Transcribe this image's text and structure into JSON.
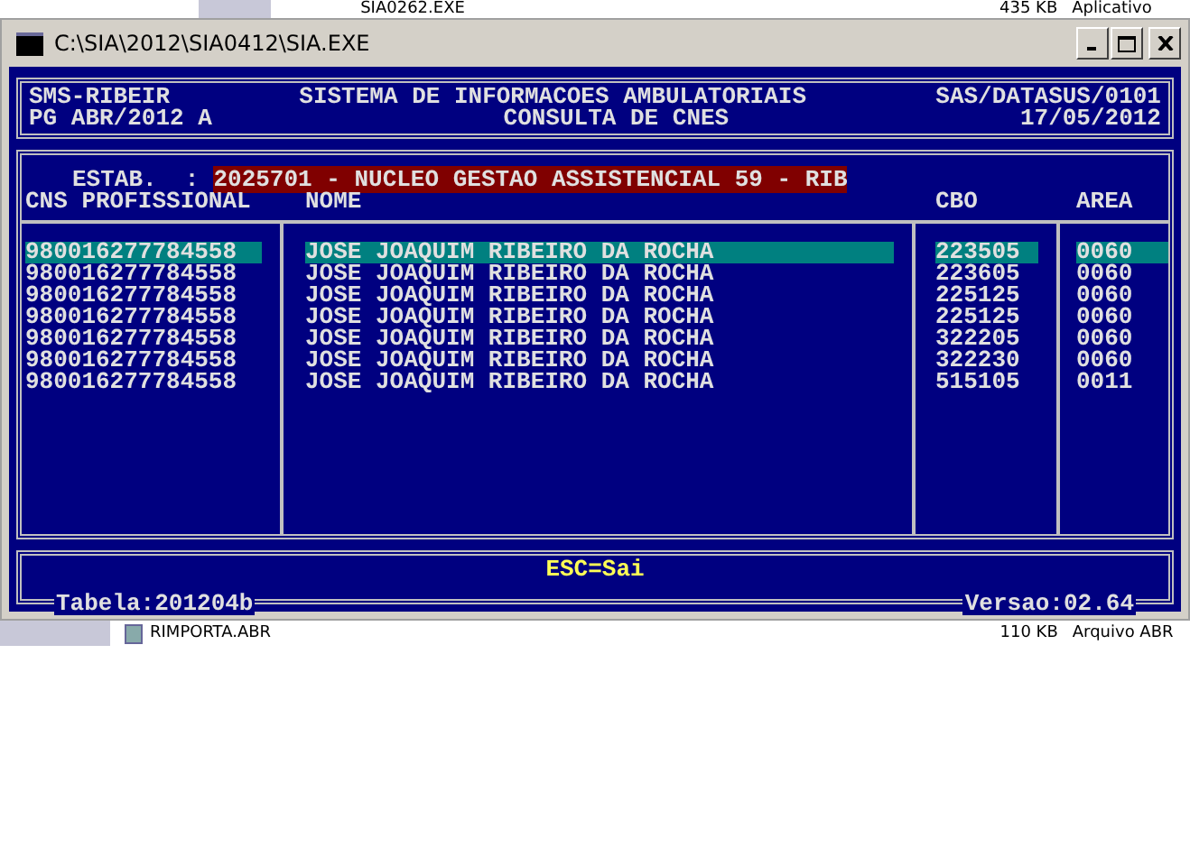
{
  "background_files": [
    {
      "name": "SIA0262.EXE",
      "size": "435 KB",
      "type": "Aplicativo"
    },
    {
      "name": "RIMPORTA.ABR",
      "size": "110 KB",
      "type": "Arquivo ABR"
    }
  ],
  "window": {
    "title": "C:\\SIA\\2012\\SIA0412\\SIA.EXE"
  },
  "header": {
    "left_1": "SMS-RIBEIR",
    "center_1": "SISTEMA DE INFORMACOES AMBULATORIAIS",
    "right_1": "SAS/DATASUS/0101",
    "left_2": "PG ABR/2012 A",
    "center_2": "CONSULTA DE CNES",
    "right_2": "17/05/2012"
  },
  "estab": {
    "label": "ESTAB.  :",
    "value": "2025701 - NUCLEO GESTAO ASSISTENCIAL 59 - RIB"
  },
  "table": {
    "columns": [
      "CNS PROFISSIONAL",
      "NOME",
      "CBO",
      "AREA"
    ],
    "rows": [
      {
        "cns": "980016277784558",
        "nome": "JOSE JOAQUIM RIBEIRO DA ROCHA",
        "cbo": "223505",
        "area": "0060",
        "selected": true
      },
      {
        "cns": "980016277784558",
        "nome": "JOSE JOAQUIM RIBEIRO DA ROCHA",
        "cbo": "223605",
        "area": "0060",
        "selected": false
      },
      {
        "cns": "980016277784558",
        "nome": "JOSE JOAQUIM RIBEIRO DA ROCHA",
        "cbo": "225125",
        "area": "0060",
        "selected": false
      },
      {
        "cns": "980016277784558",
        "nome": "JOSE JOAQUIM RIBEIRO DA ROCHA",
        "cbo": "225125",
        "area": "0060",
        "selected": false
      },
      {
        "cns": "980016277784558",
        "nome": "JOSE JOAQUIM RIBEIRO DA ROCHA",
        "cbo": "322205",
        "area": "0060",
        "selected": false
      },
      {
        "cns": "980016277784558",
        "nome": "JOSE JOAQUIM RIBEIRO DA ROCHA",
        "cbo": "322230",
        "area": "0060",
        "selected": false
      },
      {
        "cns": "980016277784558",
        "nome": "JOSE JOAQUIM RIBEIRO DA ROCHA",
        "cbo": "515105",
        "area": "0011",
        "selected": false
      }
    ]
  },
  "footer": {
    "hint": "ESC=Sai",
    "tabela": "Tabela:201204b",
    "versao": "Versao:02.64"
  }
}
